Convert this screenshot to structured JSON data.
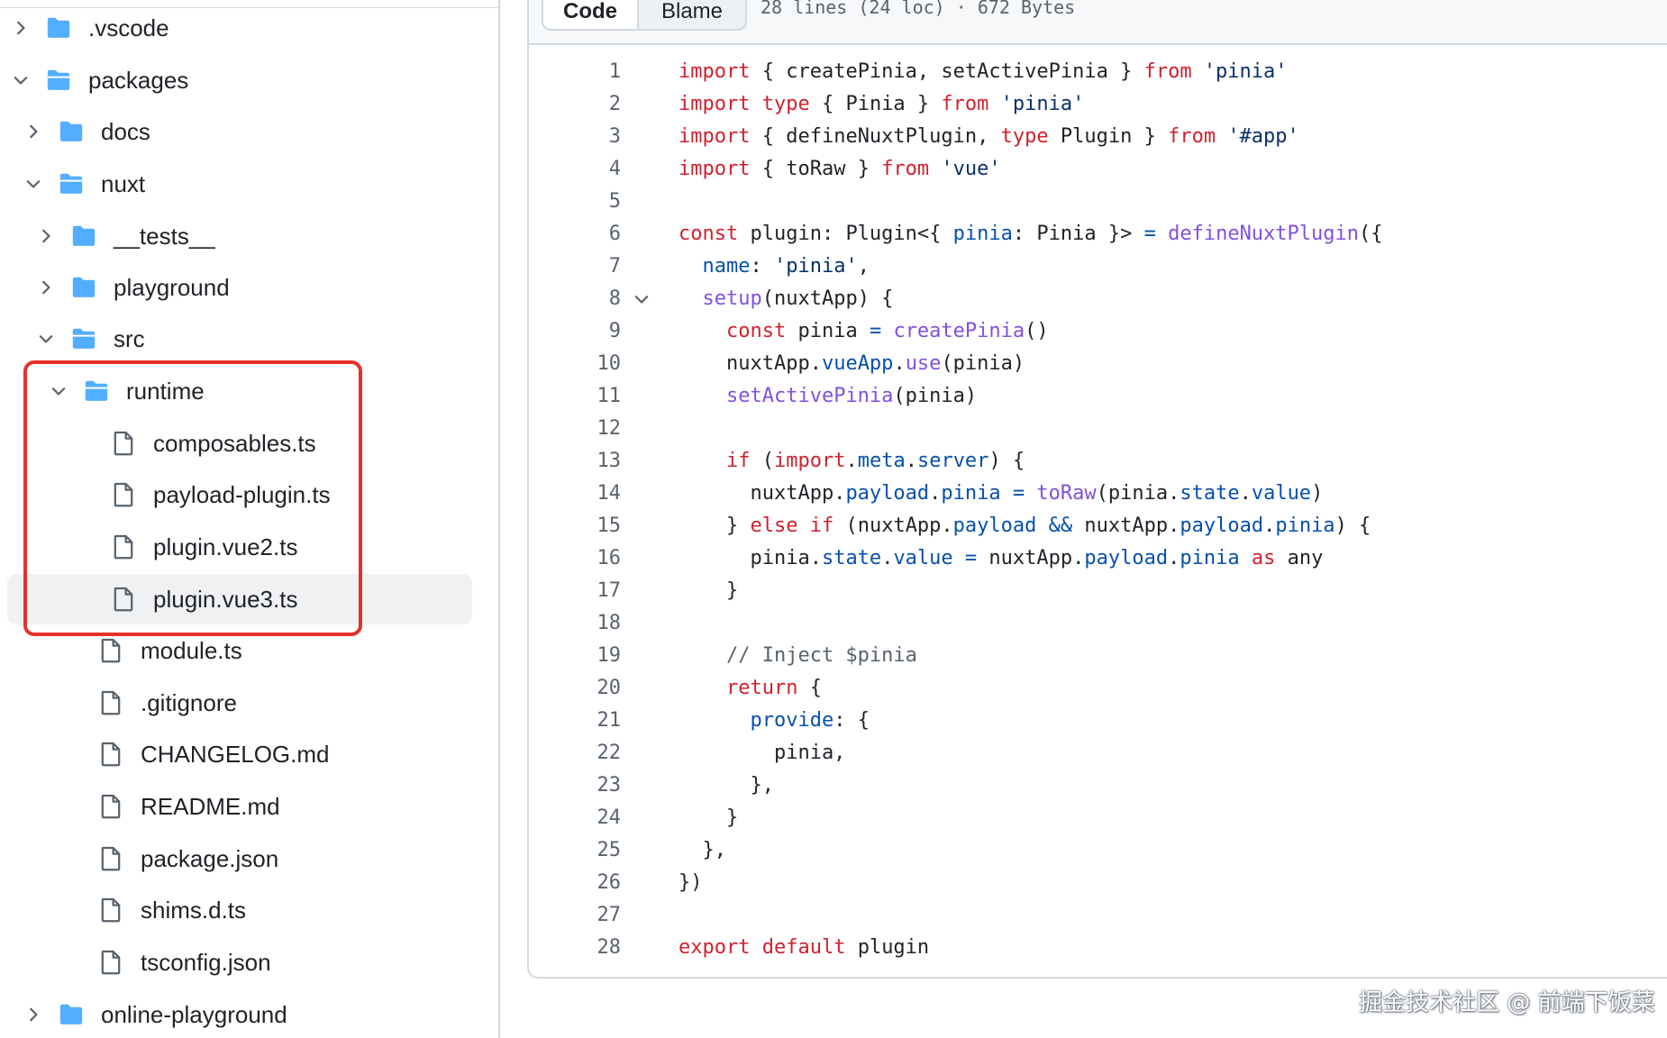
{
  "tree": {
    "rows": [
      {
        "label": ".vscode",
        "type": "folder",
        "expanded": false
      },
      {
        "label": "packages",
        "type": "folder",
        "expanded": true
      },
      {
        "label": "docs",
        "type": "folder",
        "expanded": false
      },
      {
        "label": "nuxt",
        "type": "folder",
        "expanded": true
      },
      {
        "label": "__tests__",
        "type": "folder",
        "expanded": false
      },
      {
        "label": "playground",
        "type": "folder",
        "expanded": false
      },
      {
        "label": "src",
        "type": "folder",
        "expanded": true
      },
      {
        "label": "runtime",
        "type": "folder",
        "expanded": true
      },
      {
        "label": "composables.ts",
        "type": "file"
      },
      {
        "label": "payload-plugin.ts",
        "type": "file"
      },
      {
        "label": "plugin.vue2.ts",
        "type": "file"
      },
      {
        "label": "plugin.vue3.ts",
        "type": "file",
        "selected": true
      },
      {
        "label": "module.ts",
        "type": "file"
      },
      {
        "label": ".gitignore",
        "type": "file"
      },
      {
        "label": "CHANGELOG.md",
        "type": "file"
      },
      {
        "label": "README.md",
        "type": "file"
      },
      {
        "label": "package.json",
        "type": "file"
      },
      {
        "label": "shims.d.ts",
        "type": "file"
      },
      {
        "label": "tsconfig.json",
        "type": "file"
      },
      {
        "label": "online-playground",
        "type": "folder",
        "expanded": false
      }
    ]
  },
  "code_view": {
    "tabs": {
      "code": "Code",
      "blame": "Blame"
    },
    "meta": "28 lines (24 loc) · 672 Bytes",
    "lines": [
      [
        [
          "k",
          "import"
        ],
        [
          "t",
          " { createPinia, setActivePinia } "
        ],
        [
          "k",
          "from"
        ],
        [
          "t",
          " "
        ],
        [
          "s",
          "'pinia'"
        ]
      ],
      [
        [
          "k",
          "import"
        ],
        [
          "t",
          " "
        ],
        [
          "k",
          "type"
        ],
        [
          "t",
          " { Pinia } "
        ],
        [
          "k",
          "from"
        ],
        [
          "t",
          " "
        ],
        [
          "s",
          "'pinia'"
        ]
      ],
      [
        [
          "k",
          "import"
        ],
        [
          "t",
          " { defineNuxtPlugin, "
        ],
        [
          "k",
          "type"
        ],
        [
          "t",
          " Plugin } "
        ],
        [
          "k",
          "from"
        ],
        [
          "t",
          " "
        ],
        [
          "s",
          "'#app'"
        ]
      ],
      [
        [
          "k",
          "import"
        ],
        [
          "t",
          " { toRaw } "
        ],
        [
          "k",
          "from"
        ],
        [
          "t",
          " "
        ],
        [
          "s",
          "'vue'"
        ]
      ],
      [],
      [
        [
          "k",
          "const"
        ],
        [
          "t",
          " plugin: Plugin<{ "
        ],
        [
          "p",
          "pinia"
        ],
        [
          "t",
          ": Pinia }> "
        ],
        [
          "p",
          "="
        ],
        [
          "t",
          " "
        ],
        [
          "f",
          "defineNuxtPlugin"
        ],
        [
          "t",
          "({"
        ]
      ],
      [
        [
          "t",
          "  "
        ],
        [
          "p",
          "name"
        ],
        [
          "t",
          ": "
        ],
        [
          "s",
          "'pinia'"
        ],
        [
          "t",
          ","
        ]
      ],
      [
        [
          "t",
          "  "
        ],
        [
          "f",
          "setup"
        ],
        [
          "t",
          "(nuxtApp) {"
        ]
      ],
      [
        [
          "t",
          "    "
        ],
        [
          "k",
          "const"
        ],
        [
          "t",
          " pinia "
        ],
        [
          "p",
          "="
        ],
        [
          "t",
          " "
        ],
        [
          "f",
          "createPinia"
        ],
        [
          "t",
          "()"
        ]
      ],
      [
        [
          "t",
          "    nuxtApp."
        ],
        [
          "p",
          "vueApp"
        ],
        [
          "t",
          "."
        ],
        [
          "f",
          "use"
        ],
        [
          "t",
          "(pinia)"
        ]
      ],
      [
        [
          "t",
          "    "
        ],
        [
          "f",
          "setActivePinia"
        ],
        [
          "t",
          "(pinia)"
        ]
      ],
      [],
      [
        [
          "t",
          "    "
        ],
        [
          "k",
          "if"
        ],
        [
          "t",
          " ("
        ],
        [
          "k",
          "import"
        ],
        [
          "t",
          "."
        ],
        [
          "p",
          "meta"
        ],
        [
          "t",
          "."
        ],
        [
          "p",
          "server"
        ],
        [
          "t",
          ") {"
        ]
      ],
      [
        [
          "t",
          "      nuxtApp."
        ],
        [
          "p",
          "payload"
        ],
        [
          "t",
          "."
        ],
        [
          "p",
          "pinia"
        ],
        [
          "t",
          " "
        ],
        [
          "p",
          "="
        ],
        [
          "t",
          " "
        ],
        [
          "f",
          "toRaw"
        ],
        [
          "t",
          "(pinia."
        ],
        [
          "p",
          "state"
        ],
        [
          "t",
          "."
        ],
        [
          "p",
          "value"
        ],
        [
          "t",
          ")"
        ]
      ],
      [
        [
          "t",
          "    } "
        ],
        [
          "k",
          "else"
        ],
        [
          "t",
          " "
        ],
        [
          "k",
          "if"
        ],
        [
          "t",
          " (nuxtApp."
        ],
        [
          "p",
          "payload"
        ],
        [
          "t",
          " "
        ],
        [
          "p",
          "&&"
        ],
        [
          "t",
          " nuxtApp."
        ],
        [
          "p",
          "payload"
        ],
        [
          "t",
          "."
        ],
        [
          "p",
          "pinia"
        ],
        [
          "t",
          ") {"
        ]
      ],
      [
        [
          "t",
          "      pinia."
        ],
        [
          "p",
          "state"
        ],
        [
          "t",
          "."
        ],
        [
          "p",
          "value"
        ],
        [
          "t",
          " "
        ],
        [
          "p",
          "="
        ],
        [
          "t",
          " nuxtApp."
        ],
        [
          "p",
          "payload"
        ],
        [
          "t",
          "."
        ],
        [
          "p",
          "pinia"
        ],
        [
          "t",
          " "
        ],
        [
          "k",
          "as"
        ],
        [
          "t",
          " any"
        ]
      ],
      [
        [
          "t",
          "    }"
        ]
      ],
      [],
      [
        [
          "t",
          "    "
        ],
        [
          "c",
          "// Inject $pinia"
        ]
      ],
      [
        [
          "t",
          "    "
        ],
        [
          "k",
          "return"
        ],
        [
          "t",
          " {"
        ]
      ],
      [
        [
          "t",
          "      "
        ],
        [
          "p",
          "provide"
        ],
        [
          "t",
          ": {"
        ]
      ],
      [
        [
          "t",
          "        pinia,"
        ]
      ],
      [
        [
          "t",
          "      },"
        ]
      ],
      [
        [
          "t",
          "    }"
        ]
      ],
      [
        [
          "t",
          "  },"
        ]
      ],
      [
        [
          "t",
          "})"
        ]
      ],
      [],
      [
        [
          "k",
          "export"
        ],
        [
          "t",
          " "
        ],
        [
          "k",
          "default"
        ],
        [
          "t",
          " plugin"
        ]
      ]
    ],
    "fold_line": 8
  },
  "watermark": "掘金技术社区 @ 前端下饭菜",
  "colors": {
    "keyword": "#cf222e",
    "string": "#0a3069",
    "function": "#8250df",
    "property": "#0550ae",
    "comment": "#59636e",
    "folder_icon": "#54aeff",
    "highlight_box": "#e5312b"
  },
  "icons": {
    "folder": "folder-icon",
    "file": "file-icon",
    "chevron_right": "chevron-right-icon",
    "chevron_down": "chevron-down-icon"
  }
}
